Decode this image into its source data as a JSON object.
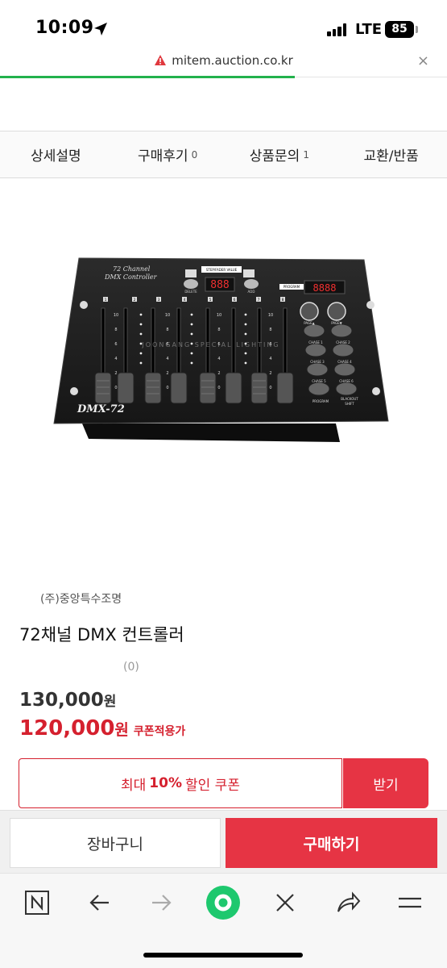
{
  "status_bar": {
    "time": "10:09",
    "network": "LTE",
    "battery": "85"
  },
  "url_bar": {
    "domain": "mitem.auction.co.kr",
    "close": "×"
  },
  "tabs": [
    {
      "label": "상세설명",
      "count": ""
    },
    {
      "label": "구매후기",
      "count": "0"
    },
    {
      "label": "상품문의",
      "count": "1"
    },
    {
      "label": "교환/반품",
      "count": ""
    }
  ],
  "product_image": {
    "panel_title_1": "72 Channel",
    "panel_title_2": "DMX Controller",
    "model": "DMX-72",
    "display": "888",
    "display2": "8888",
    "labels": {
      "step_fader": "STEP/FADER VALUE",
      "delete": "DELETE",
      "add": "ADD",
      "program_top": "PROGRAM",
      "page_up": "PAGE▲",
      "page_down": "PAGE▼",
      "chase1": "CHASE 1",
      "chase2": "CHASE 2",
      "chase3": "CHASE 3",
      "chase4": "CHASE 4",
      "chase5": "CHASE 5",
      "chase6": "CHASE 6",
      "program": "PROGRAM",
      "blackout": "BLACKOUT",
      "shift": "SHIFT",
      "watermark": "JOONGANG SPECIAL LIGHTING"
    },
    "channels": [
      "1",
      "2",
      "3",
      "4",
      "5",
      "6",
      "7",
      "8"
    ],
    "scale": [
      "10",
      "8",
      "6",
      "4",
      "2",
      "0"
    ]
  },
  "product": {
    "seller": "(주)중앙특수조명",
    "title": "72채널 DMX 컨트롤러",
    "review_count": "(0)",
    "original_price": "130,000",
    "original_unit": "원",
    "sale_price": "120,000",
    "sale_unit": "원",
    "sale_note": "쿠폰적용가"
  },
  "coupon": {
    "prefix": "최대",
    "percent": "10%",
    "suffix": "할인 쿠폰",
    "button": "받기"
  },
  "purchase": {
    "cart": "장바구니",
    "buy": "구매하기"
  },
  "colors": {
    "accent": "#e63444",
    "sale": "#d5202e",
    "progress": "#22b14c",
    "nav_green": "#1ec86e"
  },
  "nav": [
    "n-icon",
    "back-icon",
    "forward-icon",
    "home-dot-icon",
    "close-icon",
    "share-icon",
    "menu-icon"
  ]
}
